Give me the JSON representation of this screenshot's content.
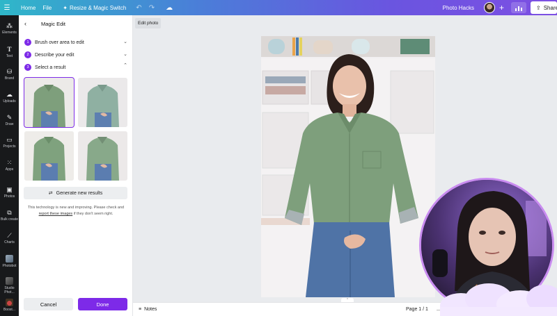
{
  "topbar": {
    "home": "Home",
    "file": "File",
    "resize": "Resize & Magic Switch",
    "project_title": "Photo Hacks",
    "share": "Share"
  },
  "rail": {
    "items": [
      "Elements",
      "Text",
      "Brand",
      "Uploads",
      "Draw",
      "Projects",
      "Apps",
      "Photos",
      "Bulk create",
      "Charts",
      "Photobot",
      "Studio Phot...",
      "Boost..."
    ]
  },
  "panel": {
    "title": "Magic Edit",
    "steps": [
      {
        "num": "1",
        "label": "Brush over area to edit"
      },
      {
        "num": "2",
        "label": "Describe your edit"
      },
      {
        "num": "3",
        "label": "Select a result"
      }
    ],
    "generate_label": "Generate new results",
    "note_prefix": "This technology is new and improving. Please check and",
    "note_link": "report these images",
    "note_suffix": "if they don't seem right.",
    "cancel": "Cancel",
    "done": "Done"
  },
  "canvas": {
    "edit_photo": "Edit photo"
  },
  "bottombar": {
    "notes": "Notes",
    "page": "Page 1 / 1"
  },
  "colors": {
    "accent": "#7d2ae8",
    "shirt": "#7e9f7c",
    "rail_bg": "#18191b"
  }
}
